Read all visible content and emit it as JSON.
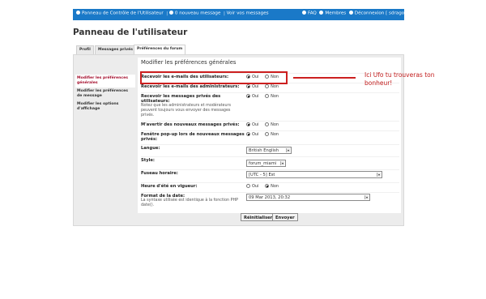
{
  "topbar": {
    "left_links": [
      "Panneau de Contrôle de l'Utilisateur",
      "0 nouveau message",
      "Voir vos messages"
    ],
    "right_links": [
      "FAQ",
      "Membres",
      "Déconnexion [ sdragon ]"
    ]
  },
  "page_title": "Panneau de l'utilisateur",
  "tabs": [
    {
      "label": "Profil",
      "active": false
    },
    {
      "label": "Messages privés",
      "active": false
    },
    {
      "label": "Préférences du forum",
      "active": true
    }
  ],
  "sidebar": {
    "items": [
      {
        "label": "Modifier les préférences générales",
        "active": true
      },
      {
        "label": "Modifier les préférences de message",
        "active": false
      },
      {
        "label": "Modifier les options d'affichage",
        "active": false
      }
    ]
  },
  "section_title": "Modifier les préférences générales",
  "fields": {
    "admin_emails": {
      "label": "Recevoir les e-mails des utilisateurs:",
      "yes": "Oui",
      "no": "Non",
      "value": "Oui"
    },
    "user_emails": {
      "label": "Recevoir les e-mails des administrateurs:",
      "yes": "Oui",
      "no": "Non",
      "value": "Oui"
    },
    "pm": {
      "label": "Recevoir les messages privés des utilisateurs:",
      "note": "Notez que les administrateurs et modérateurs peuvent toujours vous envoyer des messages privés.",
      "yes": "Oui",
      "no": "Non",
      "value": "Oui"
    },
    "notify_pm": {
      "label": "M'avertir des nouveaux messages privés:",
      "yes": "Oui",
      "no": "Non",
      "value": "Oui"
    },
    "popup_pm": {
      "label": "Fenêtre pop-up lors de nouveaux messages privés:",
      "yes": "Oui",
      "no": "Non",
      "value": "Oui"
    },
    "language": {
      "label": "Langue:",
      "value": "British English"
    },
    "style": {
      "label": "Style:",
      "value": "forum_miami"
    },
    "timezone": {
      "label": "Fuseau horaire:",
      "value": "[UTC - 5] Est"
    },
    "dst": {
      "label": "Heure d'été en vigueur:",
      "yes": "Oui",
      "no": "Non",
      "value": "Non"
    },
    "date_format": {
      "label": "Format de la date:",
      "note": "La syntaxe utilisée est identique à la fonction PHP date().",
      "value": "09 Mar 2013, 20:32"
    }
  },
  "buttons": {
    "reset": "Réinitialiser",
    "submit": "Envoyer"
  },
  "annotation": {
    "text": "Ici Ufo tu trouveras ton bonheur!",
    "color": "#cc1f1f"
  }
}
